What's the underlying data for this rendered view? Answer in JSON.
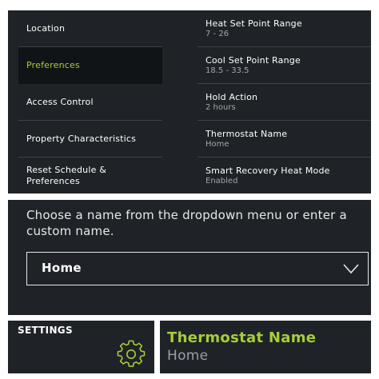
{
  "nav": {
    "items": [
      {
        "label": "Location"
      },
      {
        "label": "Preferences",
        "active": true
      },
      {
        "label": "Access Control"
      },
      {
        "label": "Property Characteristics"
      },
      {
        "label": "Reset Schedule &\nPreferences"
      }
    ]
  },
  "settings": [
    {
      "title": "Heat Set Point Range",
      "value": "7 - 26"
    },
    {
      "title": "Cool Set Point Range",
      "value": "18.5 - 33.5"
    },
    {
      "title": "Hold Action",
      "value": "2 hours"
    },
    {
      "title": "Thermostat Name",
      "value": "Home"
    },
    {
      "title": "Smart Recovery Heat Mode",
      "value": "Enabled"
    }
  ],
  "name_editor": {
    "prompt": "Choose a name from the dropdown menu or enter a custom name.",
    "dropdown_value": "Home"
  },
  "footer": {
    "settings_label": "SETTINGS",
    "thermostat_name_title": "Thermostat Name",
    "thermostat_name_value": "Home"
  },
  "colors": {
    "panel_bg": "#1f2327",
    "active_bg": "#111417",
    "accent_green": "#a8cc39",
    "divider": "#3d4248",
    "muted_text": "#a2a7ad"
  },
  "icons": {
    "gear": "gear-icon",
    "chevron": "chevron-down-icon"
  }
}
